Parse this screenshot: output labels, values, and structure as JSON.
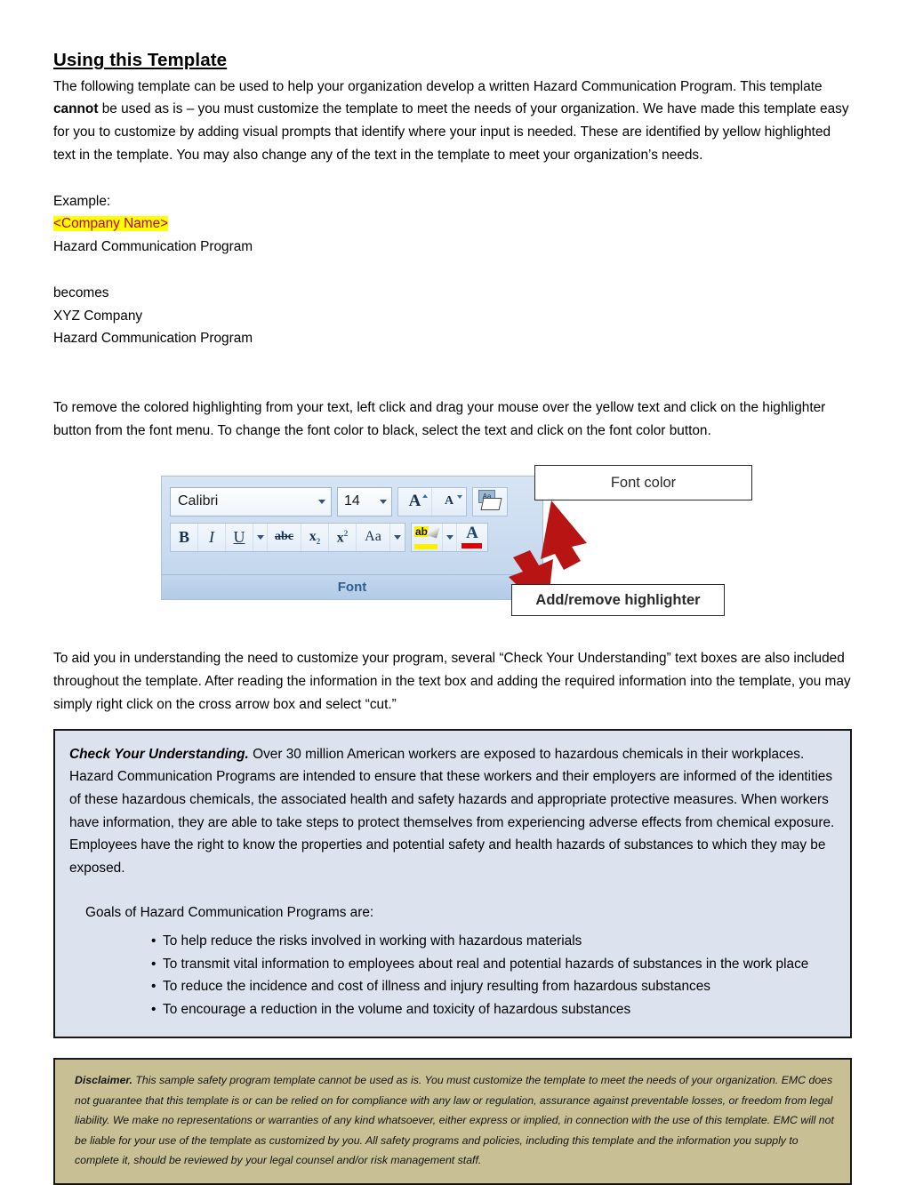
{
  "document": {
    "title": "Using this Template",
    "intro_paragraph": "The following template can be used to help your organization develop a written Hazard Communication Program. This template cannot be used as is – you must customize the template to meet the needs of your organization. We have made this template easy for you to customize by adding visual prompts that identify where your input is needed. These are identified by yellow highlighted text in the template. You may also change any of the text in the template to meet your organization’s needs.",
    "intro_before_bold": "The following template can be used to help your organization develop a written Hazard Communication Program. This template ",
    "intro_bold_word": "cannot",
    "intro_after_bold": " be used as is – you must customize the template to meet the needs of your organization. We have made this template easy for you to customize by adding visual prompts that identify where your input is needed. These are identified by yellow highlighted text in the template. You may also change any of the text in the template to meet your organization’s needs.",
    "example": {
      "label": "Example:",
      "placeholder_line": "<Company Name>",
      "placeholder_text_color": "#C00000",
      "placeholder_highlight_color": "#FFFF00",
      "program_line": "Hazard Communication Program",
      "becomes_label": "becomes",
      "company_line": "XYZ Company",
      "program_line_2": "Hazard Communication Program"
    },
    "remove_highlight_paragraph": "To remove the colored highlighting from your text, left click and drag your mouse over the yellow text and click on the highlighter button from the font menu. To change the font color to black, select the text and click on the font color button.",
    "text_box_paragraph": "To aid you in understanding the need to customize your program, several “Check Your Understanding” text boxes are also included throughout the template. After reading the information in the text box and adding the required information into the template, you may simply right click on the cross arrow box and select “cut.”"
  },
  "ribbon_image": {
    "font_name": "Calibri",
    "font_size": "14",
    "group_label": "Font",
    "buttons": {
      "bold": "B",
      "italic": "I",
      "underline": "U",
      "strikethrough": "abc",
      "subscript": "x",
      "subscript_index": "2",
      "superscript": "x",
      "superscript_index": "2",
      "change_case": "Aa",
      "grow_font": "A",
      "shrink_font": "A",
      "clear_formatting": "Aa",
      "highlighter": "ab",
      "font_color": "A"
    },
    "callouts": {
      "font_color": "Font color",
      "add_remove_highlighter": "Add/remove highlighter"
    },
    "arrow_color": "#B81414"
  },
  "check_your_understanding": {
    "heading": "Check Your Understanding.",
    "body": " Over 30 million American workers are exposed to hazardous chemicals in their workplaces. Hazard Communication Programs are intended to ensure that these workers and their employers are informed of the identities of these hazardous chemicals, the associated health and safety hazards and appropriate protective measures. When workers have information, they are able to take steps to protect themselves from experiencing adverse effects from chemical exposure. Employees have the right to know the properties and potential safety and health hazards of substances to which they may be exposed.",
    "goals_intro": "Goals of Hazard Communication Programs are:",
    "bullet_char": "•",
    "goals": [
      "To help reduce the risks involved in working with hazardous materials",
      "To transmit vital information to employees about real and potential hazards of substances in the work place",
      "To reduce the incidence and cost of illness and injury resulting from hazardous substances",
      "To encourage a reduction in the volume and toxicity of hazardous substances"
    ],
    "background_color": "#DCE3EF",
    "border_color": "#171717"
  },
  "disclaimer": {
    "heading": "Disclaimer.",
    "body": " This sample safety program template cannot be used as is. You must customize the template to meet the needs of your organization.  EMC does not guarantee that this template is or can be relied on for compliance with any law or regulation, assurance against preventable losses, or freedom from legal liability. We make no representations or warranties of any kind whatsoever, either express or implied, in connection with the use of this template. EMC will not be liable for your use of the template as customized by you.  All safety programs and policies, including this template and the information you supply to complete it, should be reviewed by your legal counsel and/or risk management staff.",
    "background_color": "#C9BF95",
    "border_color": "#171717"
  }
}
